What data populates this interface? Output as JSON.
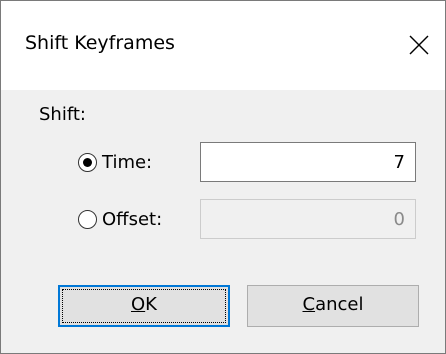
{
  "dialog": {
    "title": "Shift Keyframes",
    "close_icon": "close-icon"
  },
  "shift_group": {
    "label": "Shift:",
    "options": [
      {
        "label": "Time:",
        "checked": true,
        "value": "7",
        "enabled": true
      },
      {
        "label": "Offset:",
        "checked": false,
        "value": "0",
        "enabled": false
      }
    ]
  },
  "buttons": {
    "ok": {
      "mnemonic": "O",
      "rest": "K"
    },
    "cancel": {
      "mnemonic": "C",
      "rest": "ancel"
    }
  }
}
